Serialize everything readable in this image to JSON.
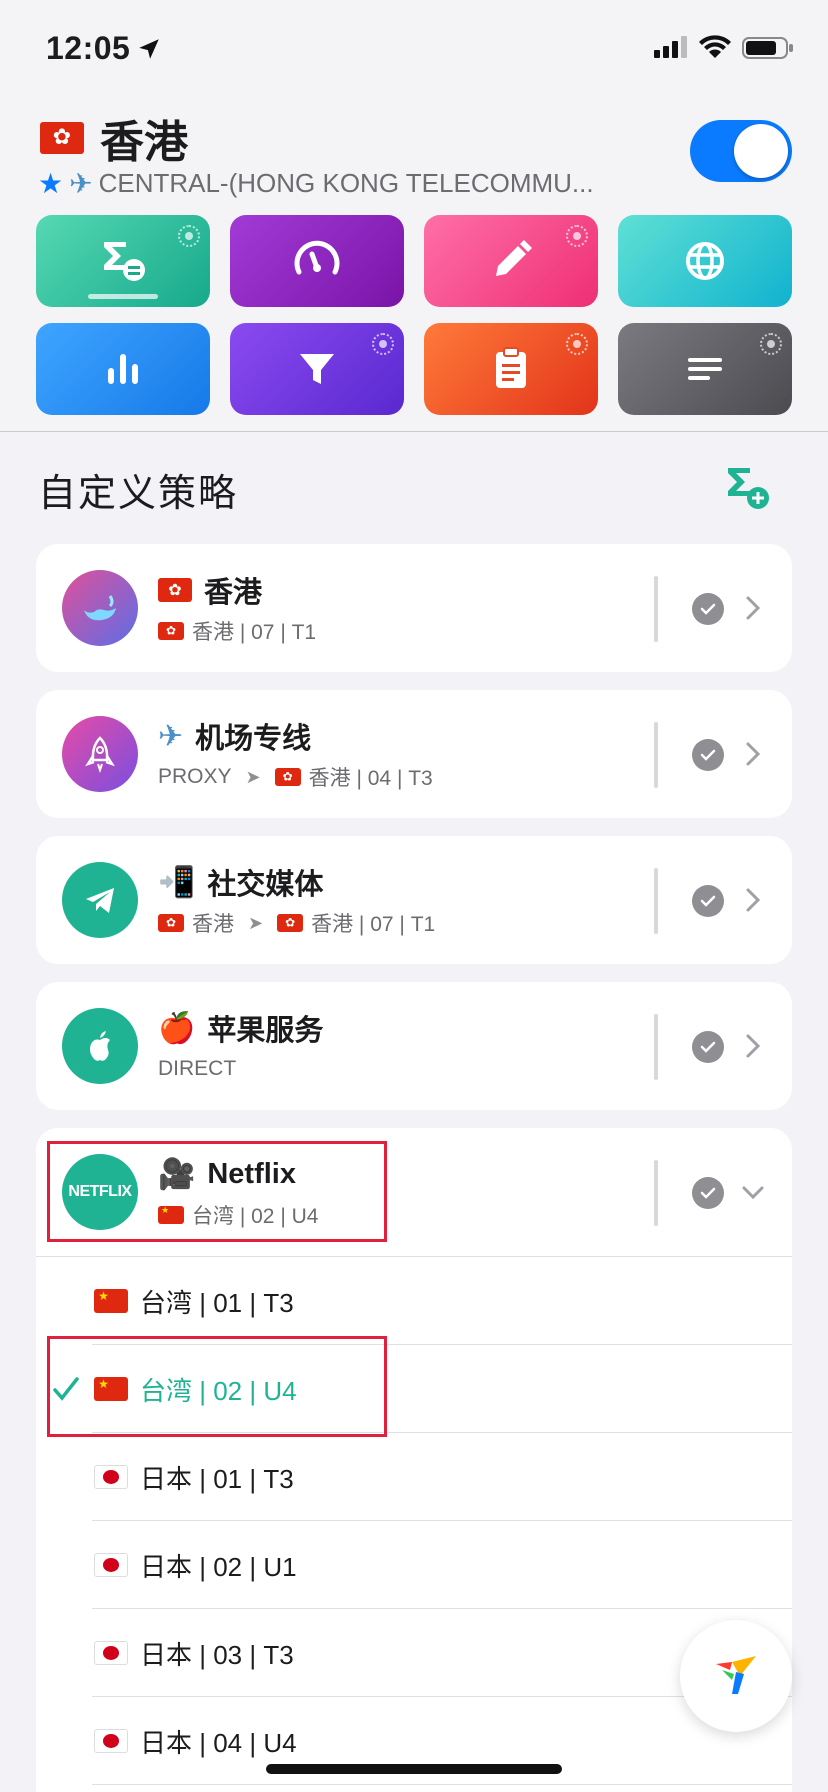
{
  "status_bar": {
    "time": "12:05"
  },
  "header": {
    "title": "香港",
    "subtitle": "CENTRAL-(HONG KONG TELECOMMU...",
    "toggle_on": true,
    "accent": "#0a7bff"
  },
  "tiles": [
    {
      "icon": "policy-group-icon",
      "color": "#16a98b",
      "selected": true
    },
    {
      "icon": "speedometer-icon",
      "color": "#7a14a8"
    },
    {
      "icon": "pencil-icon",
      "color": "#ee2f74"
    },
    {
      "icon": "globe-icon",
      "color": "#10b3cf"
    },
    {
      "icon": "bar-chart-icon",
      "color": "#1679e8"
    },
    {
      "icon": "filter-icon",
      "color": "#5a28d0"
    },
    {
      "icon": "clipboard-icon",
      "color": "#e2341a"
    },
    {
      "icon": "list-lines-icon",
      "color": "#4b4b50"
    }
  ],
  "section": {
    "title": "自定义策略"
  },
  "policies": [
    {
      "name": "香港",
      "emoji_flag": "hk",
      "avatar": "whale-icon",
      "sub": "香港 | 07 | T1"
    },
    {
      "name": "机场专线",
      "emoji": "✈",
      "avatar": "rocket-icon",
      "sub_from": "PROXY",
      "sub_to": "香港 | 04 | T3"
    },
    {
      "name": "社交媒体",
      "emoji": "📲",
      "avatar": "telegram-icon",
      "sub_from": "香港",
      "sub_to": "香港 | 07 | T1"
    },
    {
      "name": "苹果服务",
      "emoji": "🍎",
      "avatar": "apple-icon",
      "sub": "DIRECT"
    }
  ],
  "netflix": {
    "name": "Netflix",
    "emoji": "🎥",
    "logo_text": "NETFLIX",
    "sub": "台湾 | 02 | U4",
    "options": [
      {
        "label": "台湾 | 01 | T3",
        "flag": "cn",
        "selected": false
      },
      {
        "label": "台湾 | 02 | U4",
        "flag": "cn",
        "selected": true
      },
      {
        "label": "日本 | 01 | T3",
        "flag": "jp",
        "selected": false
      },
      {
        "label": "日本 | 02 | U1",
        "flag": "jp",
        "selected": false
      },
      {
        "label": "日本 | 03 | T3",
        "flag": "jp",
        "selected": false
      },
      {
        "label": "日本 | 04 | U4",
        "flag": "jp",
        "selected": false
      }
    ]
  },
  "colors": {
    "selected_text": "#1fb394",
    "highlight_box": "#e0203c"
  }
}
